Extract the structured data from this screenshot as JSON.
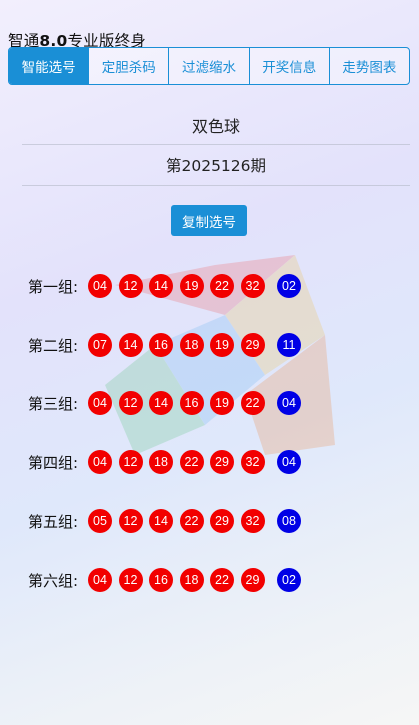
{
  "app": {
    "title_prefix": "智通",
    "title_version": "8.0",
    "title_suffix": "专业版终身"
  },
  "tabs": [
    {
      "label": "智能选号",
      "active": true
    },
    {
      "label": "定胆杀码",
      "active": false
    },
    {
      "label": "过滤缩水",
      "active": false
    },
    {
      "label": "开奖信息",
      "active": false
    },
    {
      "label": "走势图表",
      "active": false
    }
  ],
  "lottery": {
    "name": "双色球",
    "issue": "第2025126期"
  },
  "copy_button": {
    "label": "复制选号"
  },
  "colors": {
    "accent": "#1a8fd6",
    "red_ball": "#f20000",
    "blue_ball": "#0000e6"
  },
  "groups": [
    {
      "label": "第一组:",
      "red": [
        "04",
        "12",
        "14",
        "19",
        "22",
        "32"
      ],
      "blue": "02"
    },
    {
      "label": "第二组:",
      "red": [
        "07",
        "14",
        "16",
        "18",
        "19",
        "29"
      ],
      "blue": "11"
    },
    {
      "label": "第三组:",
      "red": [
        "04",
        "12",
        "14",
        "16",
        "19",
        "22"
      ],
      "blue": "04"
    },
    {
      "label": "第四组:",
      "red": [
        "04",
        "12",
        "18",
        "22",
        "29",
        "32"
      ],
      "blue": "04"
    },
    {
      "label": "第五组:",
      "red": [
        "05",
        "12",
        "14",
        "22",
        "29",
        "32"
      ],
      "blue": "08"
    },
    {
      "label": "第六组:",
      "red": [
        "04",
        "12",
        "16",
        "18",
        "22",
        "29"
      ],
      "blue": "02"
    }
  ]
}
